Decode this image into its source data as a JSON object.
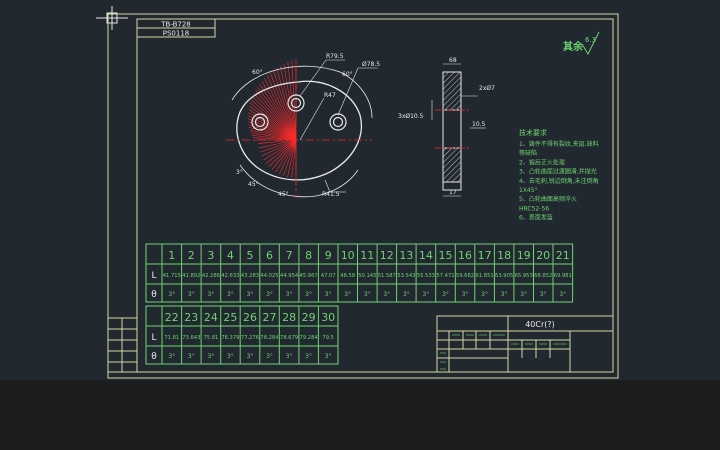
{
  "title_block": {
    "drawing_no": "TB-B728",
    "part_code": "PS0118",
    "material": "40Cr(?)"
  },
  "roughness": {
    "label": "其余",
    "value": "6.3"
  },
  "dimensions": {
    "d1": "R79.5",
    "d2": "Ø78.5",
    "d3": "R47",
    "d4": "R41.5",
    "angle1": "60°",
    "angle2": "60°",
    "angle3": "45°",
    "angle4": "45°",
    "angle5": "3°",
    "s1": "68",
    "s2": "2xØ7",
    "s3": "10.5",
    "s4": "3xØ10.5",
    "s5": "17"
  },
  "notes": {
    "heading": "技术要求",
    "lines": [
      "1、铸件不得有裂纹,夹层,缺料",
      "等缺陷",
      "2、锻后正火处理",
      "3、凸轮曲面过渡圆滑,并抛光",
      "4、去毛刺,锐边倒角,未注倒角",
      "1X45°",
      "5、凸轮曲面高频淬火",
      "HRC52-56",
      "6、表面发蓝"
    ]
  },
  "cam_table": {
    "row1_headers": [
      "1",
      "2",
      "3",
      "4",
      "5",
      "6",
      "7",
      "8",
      "9",
      "10",
      "11",
      "12",
      "13",
      "14",
      "15",
      "16",
      "17",
      "18",
      "19",
      "20",
      "21"
    ],
    "row1_L": [
      "41.715",
      "41.892",
      "42.286",
      "42.633",
      "43.283",
      "44.025",
      "44.954",
      "45.967",
      "47.07",
      "48.58",
      "50.145",
      "51.587",
      "53.543",
      "55.533",
      "57.471",
      "59.682",
      "61.851",
      "63.905",
      "65.953",
      "68.852",
      "69.981"
    ],
    "row1_angle": [
      "3°",
      "3°",
      "3°",
      "3°",
      "3°",
      "3°",
      "3°",
      "3°",
      "3°",
      "3°",
      "3°",
      "3°",
      "3°",
      "3°",
      "3°",
      "3°",
      "3°",
      "3°",
      "3°",
      "3°",
      "3°"
    ],
    "row2_headers": [
      "22",
      "23",
      "24",
      "25",
      "26",
      "27",
      "28",
      "29",
      "30"
    ],
    "row2_L": [
      "71.81",
      "73.643",
      "75.81",
      "76.379",
      "77.276",
      "78.284",
      "78.679",
      "79.284",
      "79.5"
    ],
    "row2_angle": [
      "3°",
      "3°",
      "3°",
      "3°",
      "3°",
      "3°",
      "3°",
      "3°",
      "3°"
    ],
    "label_L": "L",
    "label_theta": "θ"
  },
  "colors": {
    "frame": "#d9d9a0",
    "line": "#6fd36f",
    "text": "#6fd36f",
    "red": "#ff2a2a",
    "white": "#e8e8e8",
    "cyan": "#4fd3d3"
  }
}
